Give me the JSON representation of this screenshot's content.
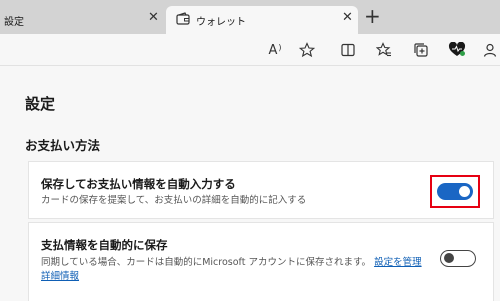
{
  "tabs": [
    {
      "label": "設定",
      "active": false
    },
    {
      "label": "ウォレット",
      "active": true
    }
  ],
  "tab_close_glyph": "✕",
  "new_tab_glyph": "+",
  "toolbar": {
    "read_aloud_glyph": "A",
    "icons": [
      "read-aloud-icon",
      "favorite-star-icon",
      "split-screen-icon",
      "favorites-icon",
      "collections-icon",
      "browser-essentials-icon",
      "profile-icon"
    ]
  },
  "page": {
    "title": "設定",
    "section_title": "お支払い方法"
  },
  "settings": {
    "autofill": {
      "title": "保存してお支払い情報を自動入力する",
      "description": "カードの保存を提案して、お支払いの詳細を自動的に記入する",
      "enabled": true
    },
    "autosave": {
      "title": "支払情報を自動的に保存",
      "description": "同期している場合、カードは自動的にMicrosoft アカウントに保存されます。",
      "link1": "設定を管理",
      "link2": "詳細情報",
      "enabled": false
    }
  },
  "colors": {
    "toggle_on": "#1a66c4",
    "highlight": "#e60012",
    "link": "#0f5fb5"
  }
}
